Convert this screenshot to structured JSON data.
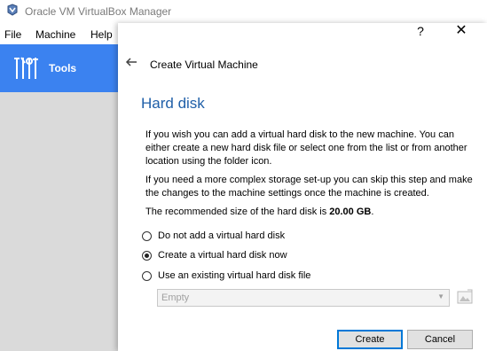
{
  "manager": {
    "title": "Oracle VM VirtualBox Manager",
    "menu": [
      "File",
      "Machine",
      "Help"
    ],
    "sidebar": {
      "tools_label": "Tools"
    }
  },
  "dialog": {
    "help_glyph": "?",
    "close_glyph": "✕",
    "heading": "Create Virtual Machine",
    "section_title": "Hard disk",
    "paragraph1": "If you wish you can add a virtual hard disk to the new machine. You can either create a new hard disk file or select one from the list or from another location using the folder icon.",
    "paragraph2": "If you need a more complex storage set-up you can skip this step and make the changes to the machine settings once the machine is created.",
    "recommended_prefix": "The recommended size of the hard disk is ",
    "recommended_size": "20.00 GB",
    "recommended_suffix": ".",
    "options": [
      {
        "label": "Do not add a virtual hard disk",
        "checked": false
      },
      {
        "label": "Create a virtual hard disk now",
        "checked": true
      },
      {
        "label": "Use an existing virtual hard disk file",
        "checked": false
      }
    ],
    "existing_disk_select": {
      "value": "Empty",
      "enabled": false
    },
    "buttons": {
      "create": "Create",
      "cancel": "Cancel"
    }
  },
  "colors": {
    "accent": "#3b82f0",
    "section_title": "#1f5fa8",
    "default_button_border": "#0078d7"
  }
}
